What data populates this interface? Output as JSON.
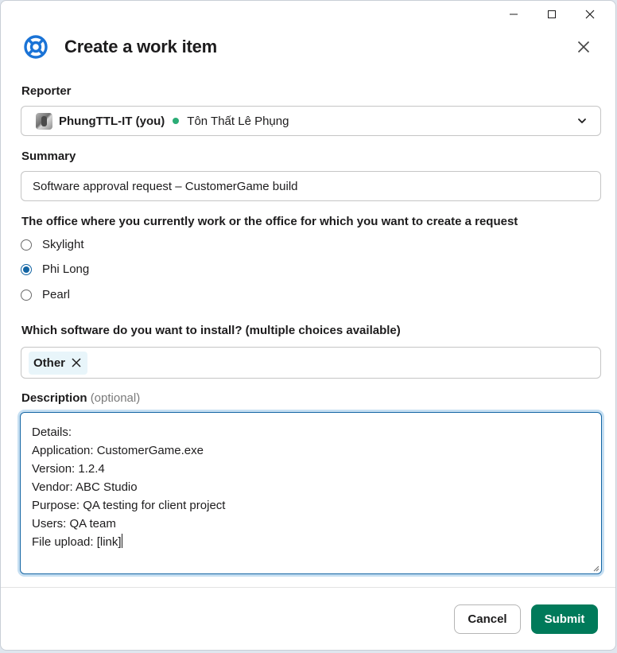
{
  "dialog": {
    "title": "Create a work item"
  },
  "reporter": {
    "label": "Reporter",
    "name": "PhungTTL-IT (you)",
    "full_name": "Tôn Thất Lê Phụng",
    "status_color": "#2bac76"
  },
  "summary": {
    "label": "Summary",
    "value": "Software approval request – CustomerGame build"
  },
  "office": {
    "label": "The office where you currently work or the office for which you want to create a request",
    "options": [
      {
        "label": "Skylight",
        "checked": false
      },
      {
        "label": "Phi Long",
        "checked": true
      },
      {
        "label": "Pearl",
        "checked": false
      }
    ]
  },
  "software": {
    "label": "Which software do you want to install? (multiple choices available)",
    "chips": [
      "Other"
    ]
  },
  "description": {
    "label": "Description",
    "optional": "(optional)",
    "value": "Details:\nApplication: CustomerGame.exe\nVersion: 1.2.4\nVendor: ABC Studio\nPurpose: QA testing for client project\nUsers: QA team\nFile upload: [link]"
  },
  "footer": {
    "cancel_label": "Cancel",
    "submit_label": "Submit",
    "submit_color": "#007a5a"
  },
  "icons": {
    "logo": "lifebuoy-icon",
    "close": "close-icon",
    "dropdown": "chevron-down-icon",
    "chip_remove": "remove-chip-icon"
  }
}
